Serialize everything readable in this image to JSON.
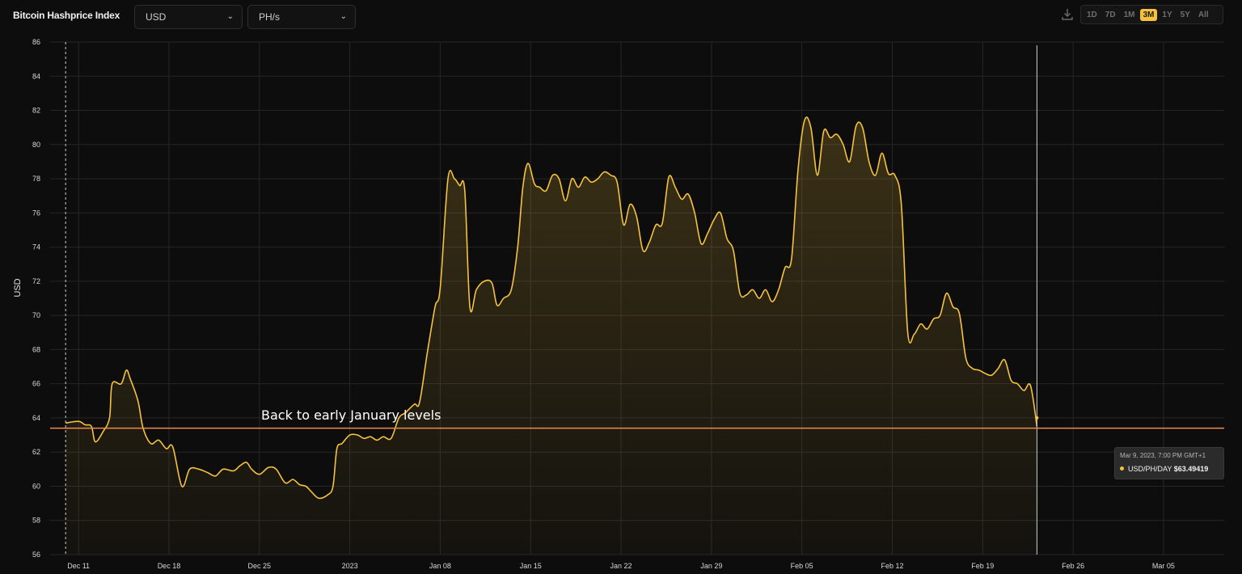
{
  "header": {
    "title": "Bitcoin Hashprice Index",
    "currency_select": "USD",
    "unit_select": "PH/s",
    "download_icon": "download-icon",
    "chevron_icon": "chevron-down-icon",
    "ranges": [
      "1D",
      "7D",
      "1M",
      "3M",
      "1Y",
      "5Y",
      "All"
    ],
    "active_range": "3M"
  },
  "annotation": {
    "text": "Back to early January levels",
    "line_value": 63.4,
    "line_color": "#f08a4b"
  },
  "tooltip": {
    "date": "Mar 9, 2023, 7:00 PM GMT+1",
    "series_label": "USD/PH/DAY",
    "value": "$63.49419"
  },
  "colors": {
    "background": "#0d0d0d",
    "line": "#f6c23e",
    "grid": "#262626"
  },
  "chart_data": {
    "type": "area",
    "ylabel": "USD",
    "ylim": [
      56,
      86
    ],
    "yticks": [
      56,
      58,
      60,
      62,
      64,
      66,
      68,
      70,
      72,
      74,
      76,
      78,
      80,
      82,
      84,
      86
    ],
    "xlim": [
      -2.2,
      88.7
    ],
    "xticks": [
      {
        "label": "Dec 11",
        "x": 0
      },
      {
        "label": "Dec 18",
        "x": 7
      },
      {
        "label": "Dec 25",
        "x": 14
      },
      {
        "label": "2023",
        "x": 21
      },
      {
        "label": "Jan 08",
        "x": 28
      },
      {
        "label": "Jan 15",
        "x": 35
      },
      {
        "label": "Jan 22",
        "x": 42
      },
      {
        "label": "Jan 29",
        "x": 49
      },
      {
        "label": "Feb 05",
        "x": 56
      },
      {
        "label": "Feb 12",
        "x": 63
      },
      {
        "label": "Feb 19",
        "x": 70
      },
      {
        "label": "Feb 26",
        "x": 77
      },
      {
        "label": "Mar 05",
        "x": 84
      }
    ],
    "grid": true,
    "series": [
      {
        "name": "USD/PH/DAY",
        "points": [
          [
            -1.0,
            63.7
          ],
          [
            0.0,
            63.8
          ],
          [
            0.5,
            63.6
          ],
          [
            1.0,
            63.5
          ],
          [
            1.3,
            62.6
          ],
          [
            1.9,
            63.2
          ],
          [
            2.4,
            64.0
          ],
          [
            2.6,
            66.0
          ],
          [
            3.3,
            66.0
          ],
          [
            3.7,
            66.8
          ],
          [
            4.0,
            66.3
          ],
          [
            4.6,
            65.0
          ],
          [
            5.0,
            63.4
          ],
          [
            5.6,
            62.5
          ],
          [
            6.2,
            62.7
          ],
          [
            6.8,
            62.2
          ],
          [
            7.3,
            62.3
          ],
          [
            8.0,
            60.0
          ],
          [
            8.6,
            61.0
          ],
          [
            9.3,
            61.0
          ],
          [
            10.0,
            60.8
          ],
          [
            10.6,
            60.6
          ],
          [
            11.2,
            61.0
          ],
          [
            12.0,
            60.9
          ],
          [
            12.5,
            61.2
          ],
          [
            13.0,
            61.4
          ],
          [
            13.4,
            61.0
          ],
          [
            14.0,
            60.7
          ],
          [
            14.7,
            61.1
          ],
          [
            15.3,
            61.0
          ],
          [
            16.0,
            60.2
          ],
          [
            16.6,
            60.4
          ],
          [
            17.1,
            60.1
          ],
          [
            17.6,
            60.0
          ],
          [
            18.0,
            59.7
          ],
          [
            18.6,
            59.3
          ],
          [
            19.3,
            59.5
          ],
          [
            19.7,
            60.0
          ],
          [
            20.0,
            62.2
          ],
          [
            20.4,
            62.5
          ],
          [
            21.0,
            63.0
          ],
          [
            21.6,
            63.0
          ],
          [
            22.1,
            62.8
          ],
          [
            22.6,
            62.9
          ],
          [
            23.1,
            62.7
          ],
          [
            23.6,
            62.9
          ],
          [
            24.2,
            62.8
          ],
          [
            24.8,
            64.0
          ],
          [
            25.3,
            64.3
          ],
          [
            26.0,
            64.8
          ],
          [
            26.4,
            64.9
          ],
          [
            27.0,
            67.8
          ],
          [
            27.6,
            70.5
          ],
          [
            28.0,
            71.6
          ],
          [
            28.6,
            78.0
          ],
          [
            29.1,
            78.0
          ],
          [
            29.5,
            77.6
          ],
          [
            29.9,
            77.3
          ],
          [
            30.3,
            70.5
          ],
          [
            30.8,
            71.5
          ],
          [
            31.4,
            72.0
          ],
          [
            32.0,
            71.9
          ],
          [
            32.4,
            70.6
          ],
          [
            32.9,
            71.0
          ],
          [
            33.5,
            71.5
          ],
          [
            34.0,
            74.0
          ],
          [
            34.4,
            77.5
          ],
          [
            34.8,
            78.9
          ],
          [
            35.3,
            77.7
          ],
          [
            35.7,
            77.5
          ],
          [
            36.2,
            77.3
          ],
          [
            36.7,
            78.2
          ],
          [
            37.2,
            78.0
          ],
          [
            37.7,
            76.7
          ],
          [
            38.2,
            78.0
          ],
          [
            38.7,
            77.5
          ],
          [
            39.2,
            78.1
          ],
          [
            39.7,
            77.8
          ],
          [
            40.2,
            78.0
          ],
          [
            40.7,
            78.4
          ],
          [
            41.2,
            78.2
          ],
          [
            41.7,
            77.8
          ],
          [
            42.2,
            75.3
          ],
          [
            42.7,
            76.5
          ],
          [
            43.2,
            75.8
          ],
          [
            43.7,
            73.8
          ],
          [
            44.2,
            74.3
          ],
          [
            44.7,
            75.3
          ],
          [
            45.2,
            75.4
          ],
          [
            45.7,
            78.1
          ],
          [
            46.2,
            77.5
          ],
          [
            46.7,
            76.8
          ],
          [
            47.2,
            77.1
          ],
          [
            47.7,
            76.0
          ],
          [
            48.2,
            74.2
          ],
          [
            48.7,
            74.8
          ],
          [
            49.2,
            75.6
          ],
          [
            49.7,
            76.0
          ],
          [
            50.2,
            74.5
          ],
          [
            50.7,
            73.8
          ],
          [
            51.2,
            71.3
          ],
          [
            51.7,
            71.2
          ],
          [
            52.2,
            71.5
          ],
          [
            52.7,
            71.0
          ],
          [
            53.2,
            71.5
          ],
          [
            53.7,
            70.8
          ],
          [
            54.2,
            71.5
          ],
          [
            54.7,
            72.8
          ],
          [
            55.2,
            73.3
          ],
          [
            55.7,
            78.5
          ],
          [
            56.2,
            81.4
          ],
          [
            56.7,
            81.0
          ],
          [
            57.2,
            78.2
          ],
          [
            57.7,
            80.8
          ],
          [
            58.2,
            80.4
          ],
          [
            58.7,
            80.6
          ],
          [
            59.2,
            80.0
          ],
          [
            59.7,
            79.0
          ],
          [
            60.2,
            81.1
          ],
          [
            60.7,
            81.0
          ],
          [
            61.2,
            79.0
          ],
          [
            61.7,
            78.2
          ],
          [
            62.2,
            79.5
          ],
          [
            62.7,
            78.3
          ],
          [
            63.2,
            78.2
          ],
          [
            63.7,
            76.5
          ],
          [
            64.2,
            69.0
          ],
          [
            64.7,
            68.9
          ],
          [
            65.2,
            69.5
          ],
          [
            65.7,
            69.2
          ],
          [
            66.2,
            69.8
          ],
          [
            66.7,
            70.0
          ],
          [
            67.2,
            71.3
          ],
          [
            67.7,
            70.5
          ],
          [
            68.2,
            70.1
          ],
          [
            68.7,
            67.5
          ],
          [
            69.2,
            66.9
          ],
          [
            69.7,
            66.8
          ],
          [
            70.2,
            66.6
          ],
          [
            70.7,
            66.5
          ],
          [
            71.2,
            66.9
          ],
          [
            71.7,
            67.4
          ],
          [
            72.2,
            66.2
          ],
          [
            72.7,
            66.0
          ],
          [
            73.2,
            65.6
          ],
          [
            73.7,
            65.9
          ],
          [
            74.2,
            63.5
          ]
        ]
      }
    ]
  }
}
